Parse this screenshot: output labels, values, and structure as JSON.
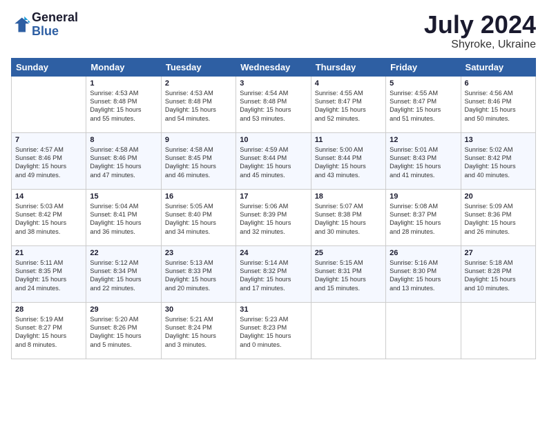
{
  "header": {
    "logo_line1": "General",
    "logo_line2": "Blue",
    "month_year": "July 2024",
    "location": "Shyroke, Ukraine"
  },
  "weekdays": [
    "Sunday",
    "Monday",
    "Tuesday",
    "Wednesday",
    "Thursday",
    "Friday",
    "Saturday"
  ],
  "weeks": [
    [
      {
        "day": "",
        "text": ""
      },
      {
        "day": "1",
        "text": "Sunrise: 4:53 AM\nSunset: 8:48 PM\nDaylight: 15 hours\nand 55 minutes."
      },
      {
        "day": "2",
        "text": "Sunrise: 4:53 AM\nSunset: 8:48 PM\nDaylight: 15 hours\nand 54 minutes."
      },
      {
        "day": "3",
        "text": "Sunrise: 4:54 AM\nSunset: 8:48 PM\nDaylight: 15 hours\nand 53 minutes."
      },
      {
        "day": "4",
        "text": "Sunrise: 4:55 AM\nSunset: 8:47 PM\nDaylight: 15 hours\nand 52 minutes."
      },
      {
        "day": "5",
        "text": "Sunrise: 4:55 AM\nSunset: 8:47 PM\nDaylight: 15 hours\nand 51 minutes."
      },
      {
        "day": "6",
        "text": "Sunrise: 4:56 AM\nSunset: 8:46 PM\nDaylight: 15 hours\nand 50 minutes."
      }
    ],
    [
      {
        "day": "7",
        "text": "Sunrise: 4:57 AM\nSunset: 8:46 PM\nDaylight: 15 hours\nand 49 minutes."
      },
      {
        "day": "8",
        "text": "Sunrise: 4:58 AM\nSunset: 8:46 PM\nDaylight: 15 hours\nand 47 minutes."
      },
      {
        "day": "9",
        "text": "Sunrise: 4:58 AM\nSunset: 8:45 PM\nDaylight: 15 hours\nand 46 minutes."
      },
      {
        "day": "10",
        "text": "Sunrise: 4:59 AM\nSunset: 8:44 PM\nDaylight: 15 hours\nand 45 minutes."
      },
      {
        "day": "11",
        "text": "Sunrise: 5:00 AM\nSunset: 8:44 PM\nDaylight: 15 hours\nand 43 minutes."
      },
      {
        "day": "12",
        "text": "Sunrise: 5:01 AM\nSunset: 8:43 PM\nDaylight: 15 hours\nand 41 minutes."
      },
      {
        "day": "13",
        "text": "Sunrise: 5:02 AM\nSunset: 8:42 PM\nDaylight: 15 hours\nand 40 minutes."
      }
    ],
    [
      {
        "day": "14",
        "text": "Sunrise: 5:03 AM\nSunset: 8:42 PM\nDaylight: 15 hours\nand 38 minutes."
      },
      {
        "day": "15",
        "text": "Sunrise: 5:04 AM\nSunset: 8:41 PM\nDaylight: 15 hours\nand 36 minutes."
      },
      {
        "day": "16",
        "text": "Sunrise: 5:05 AM\nSunset: 8:40 PM\nDaylight: 15 hours\nand 34 minutes."
      },
      {
        "day": "17",
        "text": "Sunrise: 5:06 AM\nSunset: 8:39 PM\nDaylight: 15 hours\nand 32 minutes."
      },
      {
        "day": "18",
        "text": "Sunrise: 5:07 AM\nSunset: 8:38 PM\nDaylight: 15 hours\nand 30 minutes."
      },
      {
        "day": "19",
        "text": "Sunrise: 5:08 AM\nSunset: 8:37 PM\nDaylight: 15 hours\nand 28 minutes."
      },
      {
        "day": "20",
        "text": "Sunrise: 5:09 AM\nSunset: 8:36 PM\nDaylight: 15 hours\nand 26 minutes."
      }
    ],
    [
      {
        "day": "21",
        "text": "Sunrise: 5:11 AM\nSunset: 8:35 PM\nDaylight: 15 hours\nand 24 minutes."
      },
      {
        "day": "22",
        "text": "Sunrise: 5:12 AM\nSunset: 8:34 PM\nDaylight: 15 hours\nand 22 minutes."
      },
      {
        "day": "23",
        "text": "Sunrise: 5:13 AM\nSunset: 8:33 PM\nDaylight: 15 hours\nand 20 minutes."
      },
      {
        "day": "24",
        "text": "Sunrise: 5:14 AM\nSunset: 8:32 PM\nDaylight: 15 hours\nand 17 minutes."
      },
      {
        "day": "25",
        "text": "Sunrise: 5:15 AM\nSunset: 8:31 PM\nDaylight: 15 hours\nand 15 minutes."
      },
      {
        "day": "26",
        "text": "Sunrise: 5:16 AM\nSunset: 8:30 PM\nDaylight: 15 hours\nand 13 minutes."
      },
      {
        "day": "27",
        "text": "Sunrise: 5:18 AM\nSunset: 8:28 PM\nDaylight: 15 hours\nand 10 minutes."
      }
    ],
    [
      {
        "day": "28",
        "text": "Sunrise: 5:19 AM\nSunset: 8:27 PM\nDaylight: 15 hours\nand 8 minutes."
      },
      {
        "day": "29",
        "text": "Sunrise: 5:20 AM\nSunset: 8:26 PM\nDaylight: 15 hours\nand 5 minutes."
      },
      {
        "day": "30",
        "text": "Sunrise: 5:21 AM\nSunset: 8:24 PM\nDaylight: 15 hours\nand 3 minutes."
      },
      {
        "day": "31",
        "text": "Sunrise: 5:23 AM\nSunset: 8:23 PM\nDaylight: 15 hours\nand 0 minutes."
      },
      {
        "day": "",
        "text": ""
      },
      {
        "day": "",
        "text": ""
      },
      {
        "day": "",
        "text": ""
      }
    ]
  ]
}
